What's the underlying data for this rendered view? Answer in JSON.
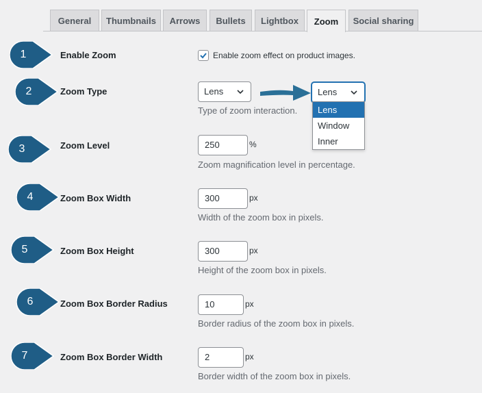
{
  "tabs": [
    {
      "label": "General"
    },
    {
      "label": "Thumbnails"
    },
    {
      "label": "Arrows"
    },
    {
      "label": "Bullets"
    },
    {
      "label": "Lightbox"
    },
    {
      "label": "Zoom",
      "active": true
    },
    {
      "label": "Social sharing"
    }
  ],
  "colors": {
    "accent": "#2271b1",
    "badge": "#1f5d86",
    "arrow": "#2a6f97"
  },
  "rows": {
    "enable_zoom": {
      "badge": "1",
      "label": "Enable Zoom",
      "checkbox_label": "Enable zoom effect on product images.",
      "checked": true
    },
    "zoom_type": {
      "badge": "2",
      "label": "Zoom Type",
      "value": "Lens",
      "open_value": "Lens",
      "options": [
        "Lens",
        "Window",
        "Inner"
      ],
      "description": "Type of zoom interaction."
    },
    "zoom_level": {
      "badge": "3",
      "label": "Zoom Level",
      "value": "250",
      "unit": "%",
      "description": "Zoom magnification level in percentage."
    },
    "zoom_box_width": {
      "badge": "4",
      "label": "Zoom Box Width",
      "value": "300",
      "unit": "px",
      "description": "Width of the zoom box in pixels."
    },
    "zoom_box_height": {
      "badge": "5",
      "label": "Zoom Box Height",
      "value": "300",
      "unit": "px",
      "description": "Height of the zoom box in pixels."
    },
    "zoom_box_border_radius": {
      "badge": "6",
      "label": "Zoom Box Border Radius",
      "value": "10",
      "unit": "px",
      "description": "Border radius of the zoom box in pixels."
    },
    "zoom_box_border_width": {
      "badge": "7",
      "label": "Zoom Box Border Width",
      "value": "2",
      "unit": "px",
      "description": "Border width of the zoom box in pixels."
    }
  }
}
